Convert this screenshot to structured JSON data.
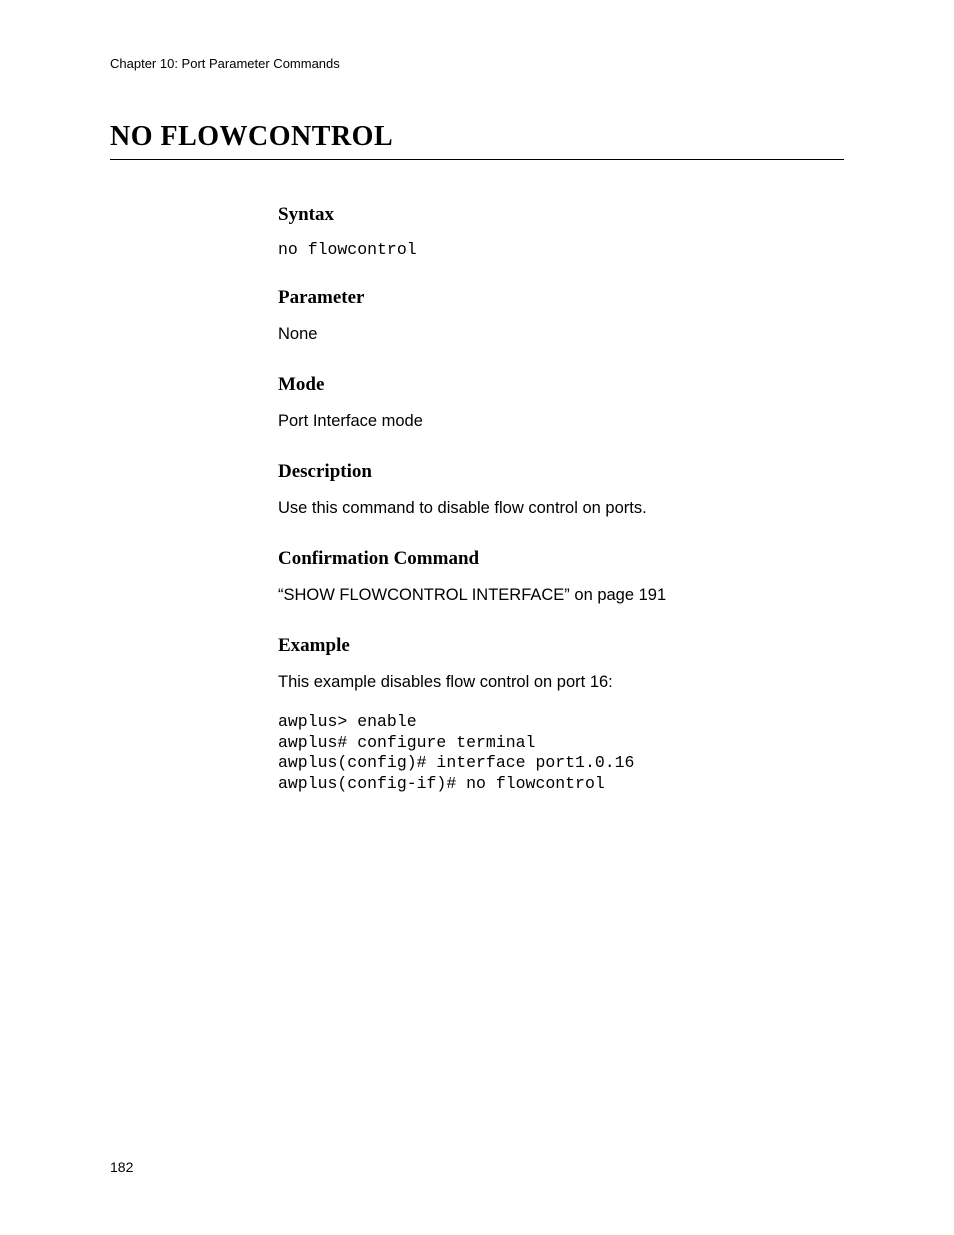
{
  "chapter_header": "Chapter 10: Port Parameter Commands",
  "title": "NO FLOWCONTROL",
  "sections": {
    "syntax": {
      "heading": "Syntax",
      "content": "no flowcontrol"
    },
    "parameter": {
      "heading": "Parameter",
      "content": "None"
    },
    "mode": {
      "heading": "Mode",
      "content": "Port Interface mode"
    },
    "description": {
      "heading": "Description",
      "content": "Use this command to disable flow control on ports."
    },
    "confirmation": {
      "heading": "Confirmation Command",
      "content": "“SHOW FLOWCONTROL INTERFACE” on page 191"
    },
    "example": {
      "heading": "Example",
      "intro": "This example disables flow control on port 16:",
      "code": "awplus> enable\nawplus# configure terminal\nawplus(config)# interface port1.0.16\nawplus(config-if)# no flowcontrol"
    }
  },
  "page_number": "182"
}
